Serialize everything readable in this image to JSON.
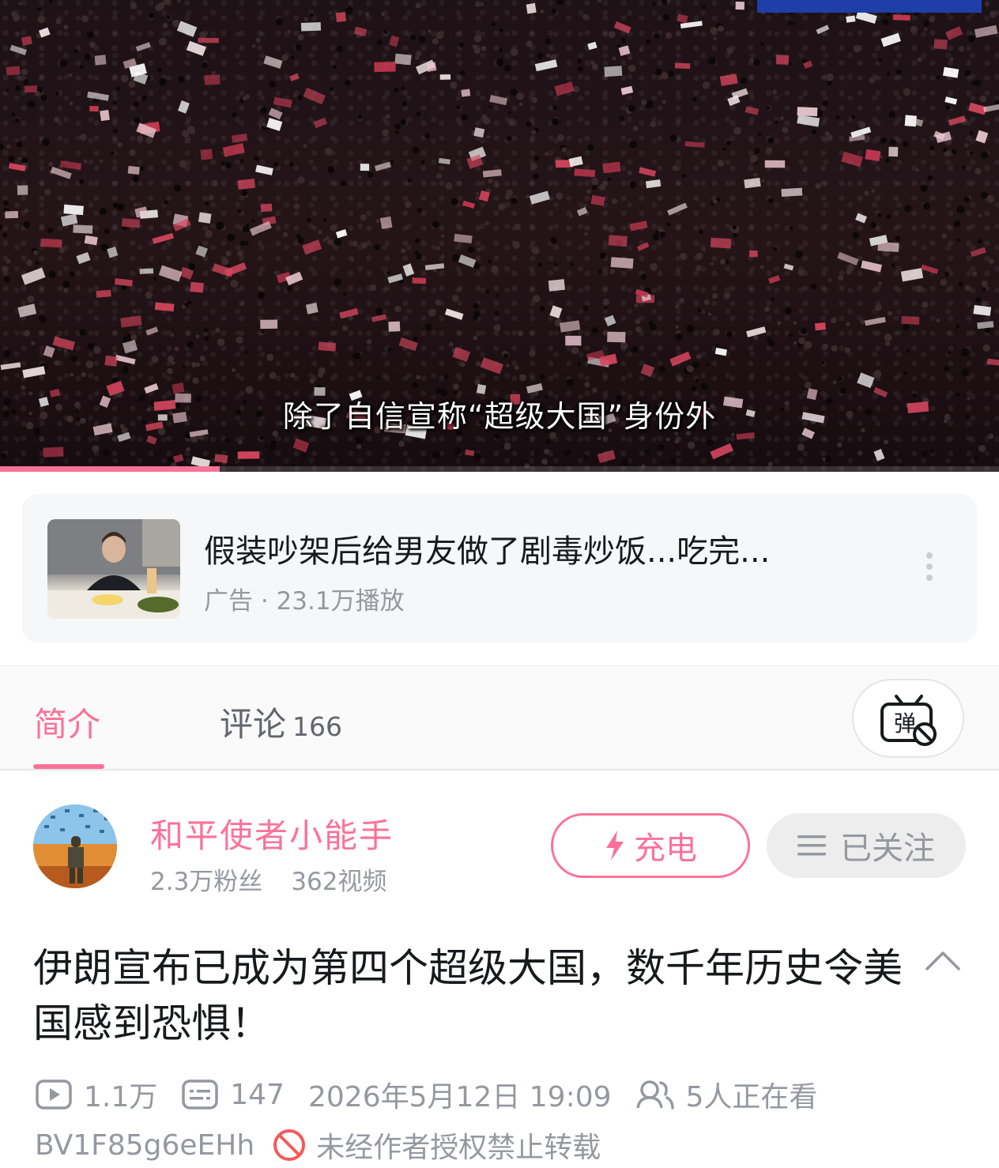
{
  "player": {
    "subtitle": "除了自信宣称“超级大国”身份外",
    "progress_fraction": 0.22,
    "accent_color": "#fb7299"
  },
  "ad": {
    "title": "假装吵架后给男友做了剧毒炒饭...吃完...",
    "meta": "广告 · 23.1万播放",
    "more_icon": "more-vertical-icon"
  },
  "tabs": {
    "intro_label": "简介",
    "comments_label": "评论",
    "comments_count": "166",
    "danmaku_icon": "danmaku-off-icon",
    "danmaku_glyph": "弹"
  },
  "uploader": {
    "name": "和平使者小能手",
    "followers": "2.3万粉丝",
    "videos": "362视频",
    "charge_label": "充电",
    "follow_label": "已关注"
  },
  "video": {
    "title": "伊朗宣布已成为第四个超级大国，数千年历史令美国感到恐惧！",
    "views": "1.1万",
    "danmaku_count": "147",
    "datetime": "2026年5月12日 19:09",
    "watching": "5人正在看",
    "bvid": "BV1F85g6eEHh",
    "repost_notice": "未经作者授权禁止转载"
  }
}
